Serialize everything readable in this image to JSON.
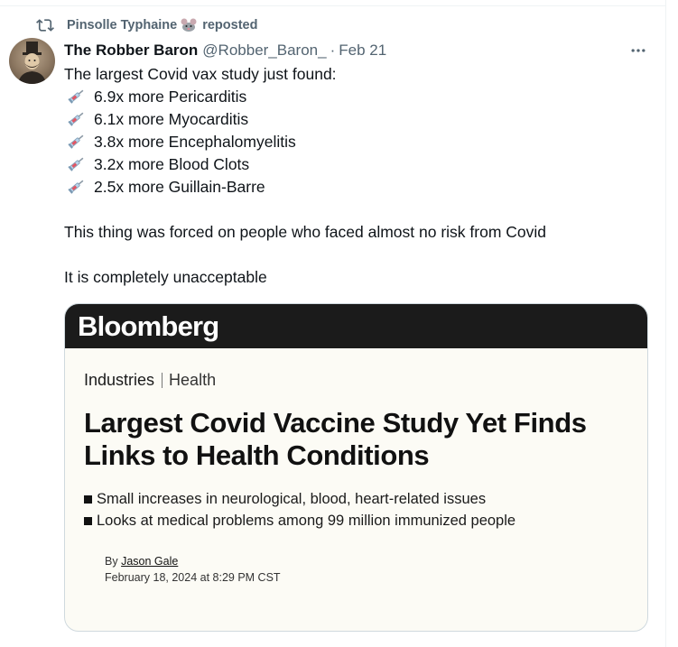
{
  "repost": {
    "user": "Pinsolle Typhaine",
    "icon": "rat-emoji",
    "label": "reposted"
  },
  "tweet": {
    "display_name": "The Robber Baron",
    "handle": "@Robber_Baron_",
    "separator": "·",
    "date": "Feb 21",
    "more_icon": "more-horizontal-icon",
    "intro": "The largest Covid vax study just found:",
    "findings": [
      "6.9x more Pericarditis",
      "6.1x more Myocarditis",
      "3.8x more Encephalomyelitis",
      "3.2x more Blood Clots",
      "2.5x more Guillain-Barre"
    ],
    "bullet_icon": "syringe-emoji",
    "paragraph_2": "This thing was forced on people who faced almost no risk from Covid",
    "paragraph_3": "It is completely unacceptable"
  },
  "card": {
    "brand": "Bloomberg",
    "section": "Industries",
    "subsection": "Health",
    "headline_line1": "Largest Covid Vaccine Study Yet Finds",
    "headline_line2": "Links to Health Conditions",
    "bullets": [
      "Small increases in neurological, blood, heart-related issues",
      "Looks at medical problems among 99 million immunized people"
    ],
    "byline_prefix": "By",
    "author": "Jason Gale",
    "published": "February 18, 2024 at 8:29 PM CST"
  },
  "colors": {
    "text_primary": "#0f1419",
    "text_secondary": "#536471",
    "border": "#cfd9de",
    "card_background": "#fcfbf5",
    "brand_bar": "#1b1b1b"
  }
}
